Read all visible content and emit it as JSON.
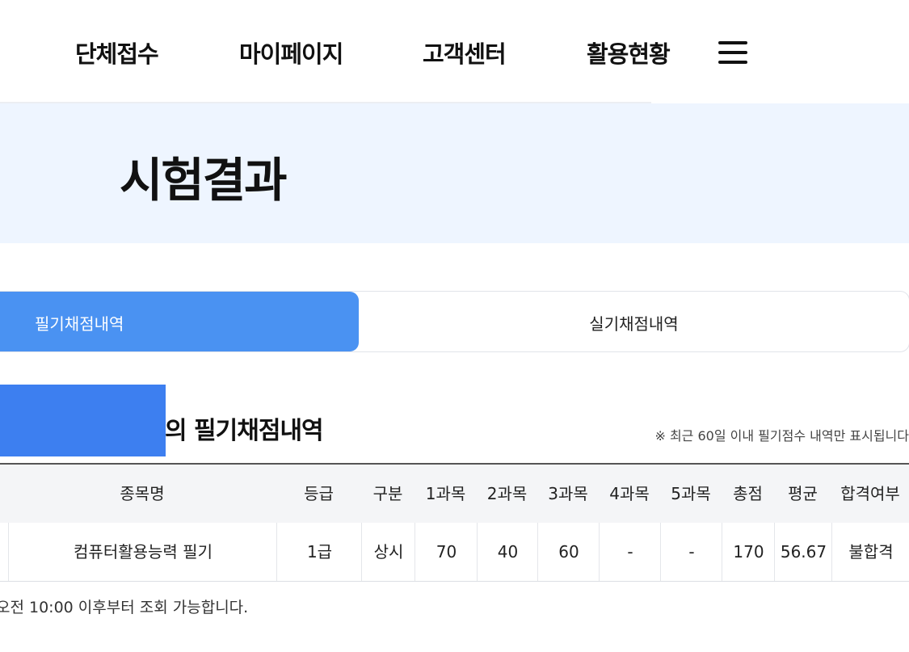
{
  "nav": {
    "items": [
      "단체접수",
      "마이페이지",
      "고객센터",
      "활용현황"
    ],
    "menu_icon": "hamburger-menu-icon"
  },
  "hero": {
    "title": "시험결과"
  },
  "tabs": {
    "active_label": "필기채점내역",
    "inactive_label": "실기채점내역"
  },
  "section": {
    "title": "의 필기채점내역",
    "notice": "※ 최근 60일 이내 필기점수 내역만 표시됩니다"
  },
  "table": {
    "headers": [
      "종목명",
      "등급",
      "구분",
      "1과목",
      "2과목",
      "3과목",
      "4과목",
      "5과목",
      "총점",
      "평균",
      "합격여부"
    ],
    "rows": [
      [
        "컴퓨터활용능력 필기",
        "1급",
        "상시",
        "70",
        "40",
        "60",
        "-",
        "-",
        "170",
        "56.67",
        "불합격"
      ]
    ]
  },
  "footnote": "오전 10:00 이후부터 조회 가능합니다.",
  "colors": {
    "accent": "#4a92f2",
    "hero_bg": "#eef5ff",
    "mask": "#3d7ff0"
  }
}
